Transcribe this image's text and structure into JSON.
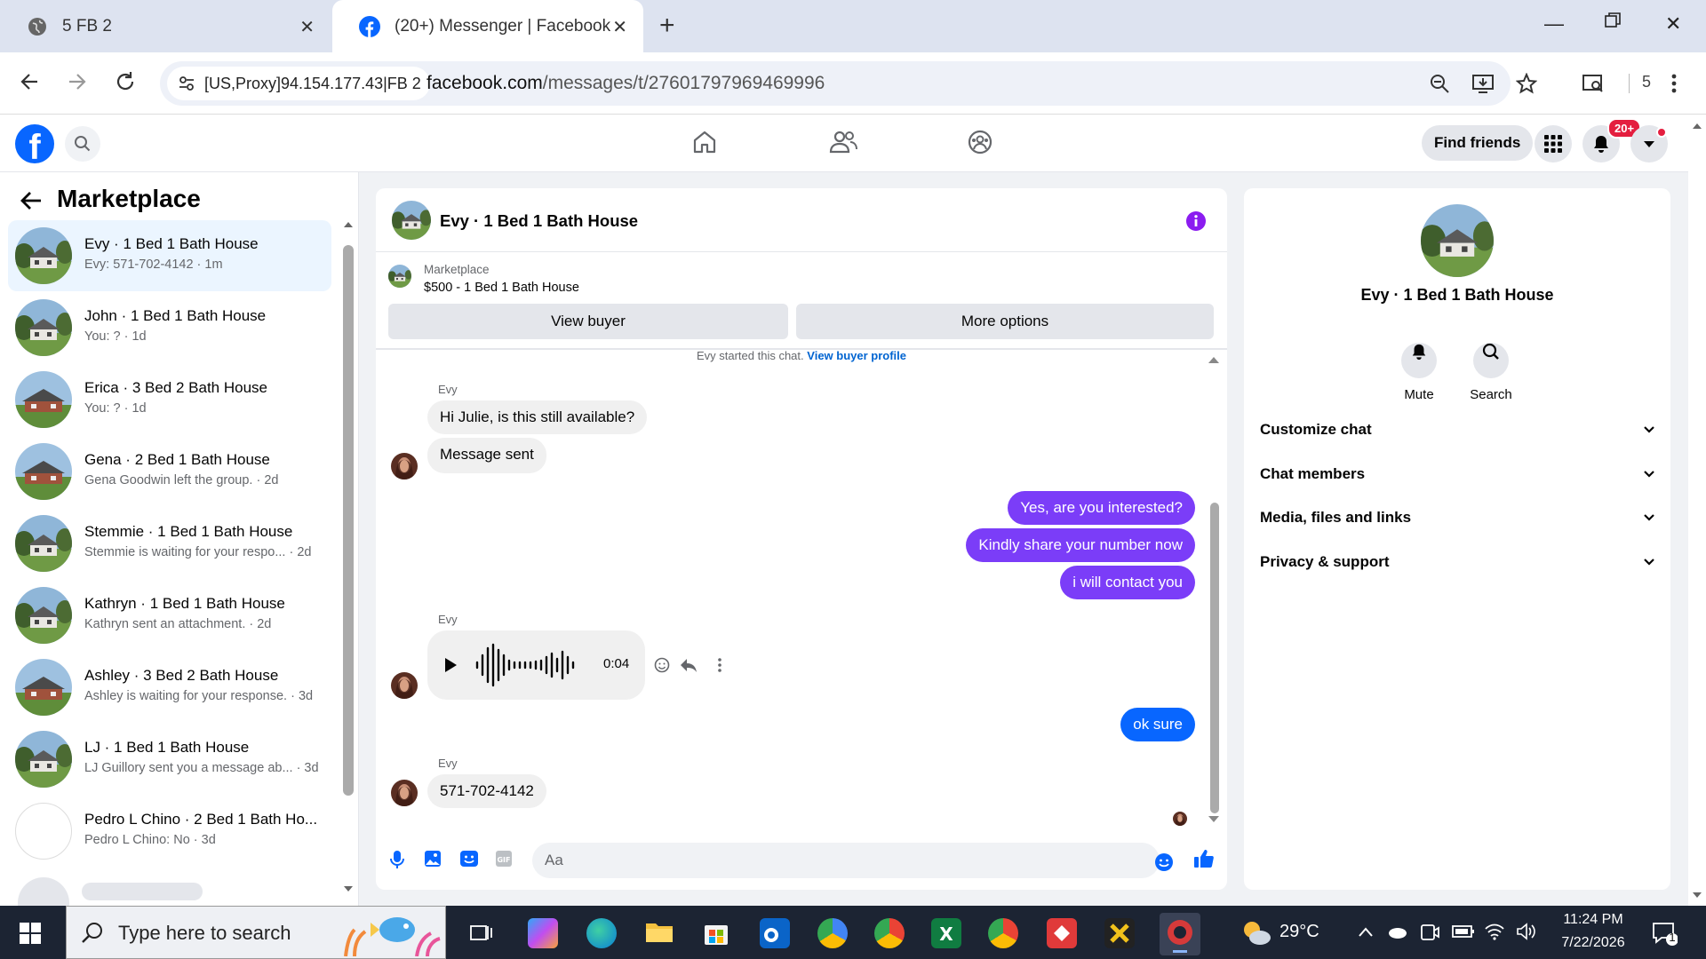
{
  "browser": {
    "tabs": [
      {
        "title": "5 FB 2"
      },
      {
        "title": "(20+) Messenger | Facebook"
      }
    ],
    "proxy_chip": "[US,Proxy]94.154.177.43|FB 2",
    "url_host": "facebook.com",
    "url_path": "/messages/t/27601797969469996",
    "profile_count": "5"
  },
  "fb_header": {
    "find_friends": "Find friends",
    "notif_badge": "20+"
  },
  "sidebar": {
    "title": "Marketplace",
    "conversations": [
      {
        "name": "Evy · 1 Bed 1 Bath House",
        "preview": "Evy: 571-702-4142 · 1m"
      },
      {
        "name": "John · 1 Bed 1 Bath House",
        "preview": "You: ? · 1d"
      },
      {
        "name": "Erica · 3 Bed 2 Bath House",
        "preview": "You: ? · 1d"
      },
      {
        "name": "Gena · 2 Bed 1 Bath House",
        "preview": "Gena Goodwin left the group. · 2d"
      },
      {
        "name": "Stemmie · 1 Bed 1 Bath House",
        "preview": "Stemmie is waiting for your respo... · 2d"
      },
      {
        "name": "Kathryn · 1 Bed 1 Bath House",
        "preview": "Kathryn sent an attachment. · 2d"
      },
      {
        "name": "Ashley · 3 Bed 2 Bath House",
        "preview": "Ashley is waiting for your response. · 3d"
      },
      {
        "name": "LJ · 1 Bed 1 Bath House",
        "preview": "LJ Guillory sent you a message ab... · 3d"
      },
      {
        "name": "Pedro L Chino · 2 Bed 1 Bath Ho...",
        "preview": "Pedro L Chino: No · 3d"
      }
    ]
  },
  "chat": {
    "title": "Evy · 1 Bed 1 Bath House",
    "marketplace_label": "Marketplace",
    "listing": "$500 - 1 Bed 1 Bath House",
    "view_buyer": "View buyer",
    "more_options": "More options",
    "started_text": "Evy started this chat.",
    "view_buyer_profile": "View buyer profile",
    "sender_name": "Evy",
    "messages": {
      "m1": "Hi Julie, is this still available?",
      "m2": "Message sent",
      "m3": "Yes, are you interested?",
      "m4": "Kindly share your number now",
      "m5": "i will contact you",
      "audio_duration": "0:04",
      "m6": "ok sure",
      "m7": "571-702-4142"
    },
    "composer_placeholder": "Aa"
  },
  "right_panel": {
    "name": "Evy · 1 Bed 1 Bath House",
    "mute": "Mute",
    "search": "Search",
    "sections": [
      "Customize chat",
      "Chat members",
      "Media, files and links",
      "Privacy & support"
    ]
  },
  "taskbar": {
    "search_placeholder": "Type here to search",
    "weather": "29°C",
    "time": "11:24 PM",
    "date": "7/22/2026",
    "notif_count": "1"
  }
}
